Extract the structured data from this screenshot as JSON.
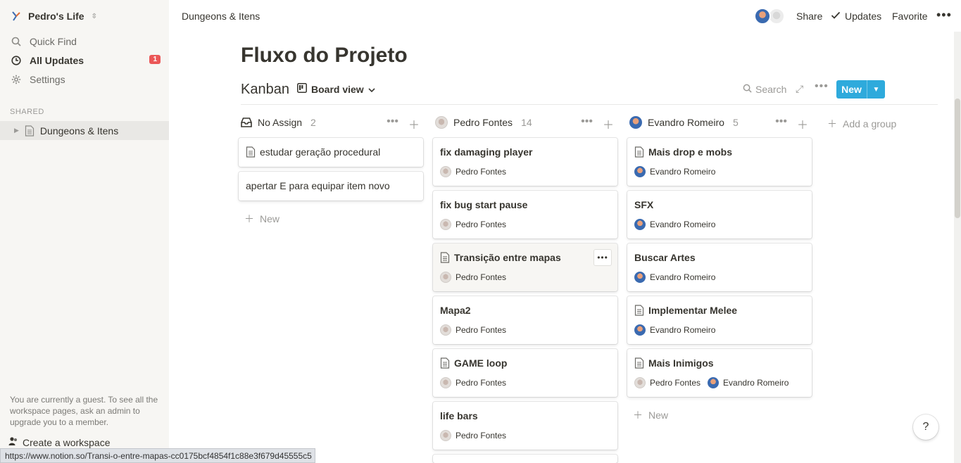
{
  "sidebar": {
    "workspace_name": "Pedro's Life",
    "items": [
      {
        "label": "Quick Find",
        "icon": "search-icon"
      },
      {
        "label": "All Updates",
        "icon": "clock-icon",
        "badge": "1"
      },
      {
        "label": "Settings",
        "icon": "gear-icon"
      }
    ],
    "section_label": "SHARED",
    "pages": [
      {
        "label": "Dungeons & Itens",
        "icon": "page-icon"
      }
    ],
    "guest_message": "You are currently a guest. To see all the workspace pages, ask an admin to upgrade you to a member.",
    "create_workspace": "Create a workspace"
  },
  "topbar": {
    "breadcrumb": "Dungeons & Itens",
    "share": "Share",
    "updates": "Updates",
    "favorite": "Favorite"
  },
  "page": {
    "title": "Fluxo do Projeto",
    "db_title": "Kanban",
    "view_label": "Board view",
    "search_label": "Search",
    "new_label": "New"
  },
  "board": {
    "columns": [
      {
        "name": "No Assign",
        "count": "2",
        "cards": [
          {
            "title": "estudar geração procedural",
            "doc": true
          },
          {
            "title": "apertar E para equipar item novo",
            "doc": false
          }
        ],
        "new_label": "New"
      },
      {
        "name": "Pedro Fontes",
        "count": "14",
        "cards": [
          {
            "title": "fix damaging player",
            "person": "Pedro Fontes"
          },
          {
            "title": "fix bug start pause",
            "person": "Pedro Fontes"
          },
          {
            "title": "Transição entre mapas",
            "person": "Pedro Fontes",
            "doc": true
          },
          {
            "title": "Mapa2",
            "person": "Pedro Fontes"
          },
          {
            "title": "GAME loop",
            "person": "Pedro Fontes",
            "doc": true
          },
          {
            "title": "life bars",
            "person": "Pedro Fontes"
          }
        ]
      },
      {
        "name": "Evandro Romeiro",
        "count": "5",
        "cards": [
          {
            "title": "Mais drop e mobs",
            "person": "Evandro Romeiro",
            "doc": true
          },
          {
            "title": "SFX",
            "person": "Evandro Romeiro"
          },
          {
            "title": "Buscar Artes",
            "person": "Evandro Romeiro"
          },
          {
            "title": "Implementar Melee",
            "person": "Evandro Romeiro",
            "doc": true
          },
          {
            "title": "Mais Inimigos",
            "person": "Pedro Fontes",
            "person2": "Evandro Romeiro",
            "doc": true
          }
        ],
        "new_label": "New"
      }
    ],
    "add_group": "Add a group"
  },
  "help_label": "?",
  "status_url": "https://www.notion.so/Transi-o-entre-mapas-cc0175bcf4854f1c88e3f679d45555c5",
  "colors": {
    "accent": "#2eaadc",
    "badge": "#eb5757",
    "sidebar_bg": "#f7f6f3"
  }
}
